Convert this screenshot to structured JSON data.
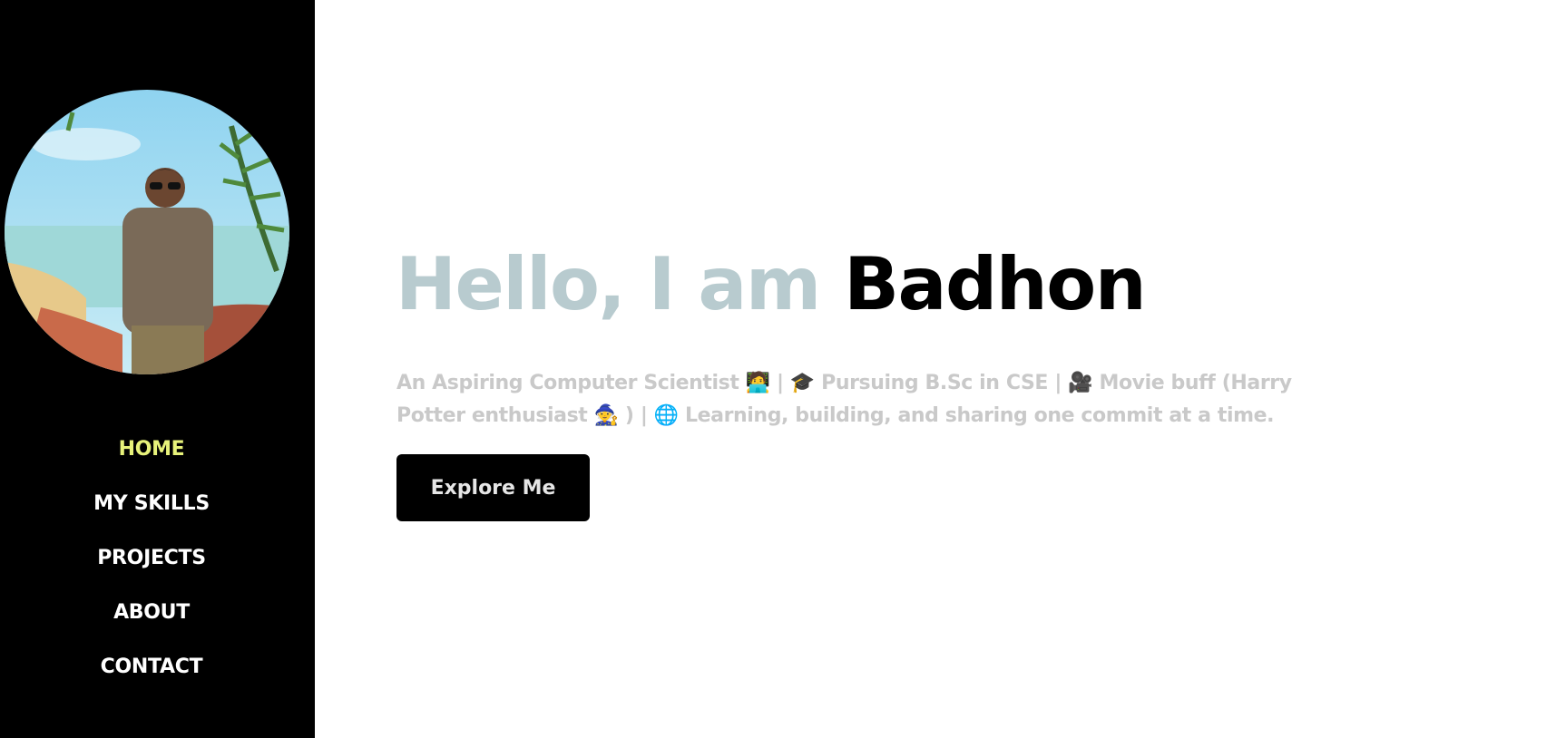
{
  "nav": {
    "items": [
      {
        "label": "HOME",
        "active": true
      },
      {
        "label": "MY SKILLS",
        "active": false
      },
      {
        "label": "PROJECTS",
        "active": false
      },
      {
        "label": "ABOUT",
        "active": false
      },
      {
        "label": "CONTACT",
        "active": false
      }
    ],
    "active_color": "#e7f27a"
  },
  "hero": {
    "greeting": "Hello, I am ",
    "name": "Badhon",
    "description": "An Aspiring Computer Scientist 🧑‍💻 | 🎓 Pursuing B.Sc in CSE | 🎥 Movie buff (Harry Potter enthusiast 🧙 ) | 🌐 Learning, building, and sharing one commit at a time.",
    "button_label": "Explore Me"
  },
  "colors": {
    "sidebar": "#000000",
    "greeting": "#b8cbcf",
    "description": "#c9c9c9"
  }
}
